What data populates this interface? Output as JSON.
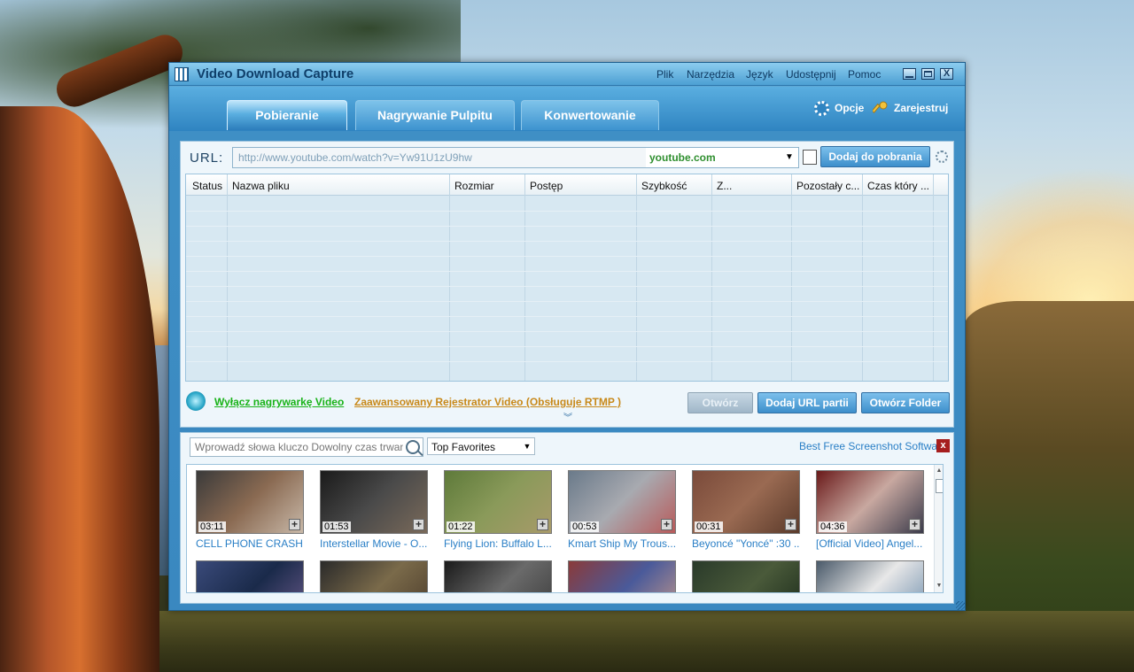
{
  "app": {
    "title": "Video Download Capture"
  },
  "menu": [
    {
      "label": "Plik"
    },
    {
      "label": "Narzędzia"
    },
    {
      "label": "Język"
    },
    {
      "label": "Udostępnij"
    },
    {
      "label": "Pomoc"
    }
  ],
  "window_controls": {
    "close_glyph": "X"
  },
  "tabs": [
    {
      "label": "Pobieranie",
      "active": true
    },
    {
      "label": "Nagrywanie Pulpitu",
      "active": false
    },
    {
      "label": "Konwertowanie",
      "active": false
    }
  ],
  "toolbar": {
    "options_label": "Opcje",
    "register_label": "Zarejestruj"
  },
  "url_bar": {
    "label": "URL:",
    "value": "http://www.youtube.com/watch?v=Yw91U1zU9hw",
    "site": "youtube.com",
    "add_button": "Dodaj do pobrania"
  },
  "table": {
    "columns": [
      "Status",
      "Nazwa pliku",
      "Rozmiar",
      "Postęp",
      "Szybkość",
      "Z...",
      "Pozostały c...",
      "Czas który ..."
    ],
    "rows": []
  },
  "actions": {
    "toggle_recorder": "Wyłącz nagrywarkę Video",
    "advanced_recorder": "Zaawansowany Rejestrator Video  (Obsługuje RTMP )",
    "open_button": "Otwórz",
    "add_batch_button": "Dodaj URL partii",
    "open_folder_button": "Otwórz Folder"
  },
  "gallery": {
    "search_placeholder": "Wprowadź słowa kluczo Dowolny czas trwania",
    "category": "Top Favorites",
    "promo_link": "Best Free Screenshot Software",
    "close_glyph": "x",
    "add_glyph": "+",
    "videos": [
      {
        "duration": "03:11",
        "title": "CELL PHONE CRASHI...",
        "colors": [
          "#3a3a3a",
          "#8a6a52",
          "#c8b8a8"
        ]
      },
      {
        "duration": "01:53",
        "title": "Interstellar Movie - O...",
        "colors": [
          "#1a1a1a",
          "#4a4a4a",
          "#7a6a5a"
        ]
      },
      {
        "duration": "01:22",
        "title": "Flying Lion: Buffalo L...",
        "colors": [
          "#5e7a3a",
          "#8a9a5a",
          "#a89a6a"
        ]
      },
      {
        "duration": "00:53",
        "title": "Kmart Ship My Trous...",
        "colors": [
          "#6a7a8a",
          "#a8aab0",
          "#b85a5a"
        ]
      },
      {
        "duration": "00:31",
        "title": "Beyoncé \"Yoncé\" :30 ...",
        "colors": [
          "#7a4a3a",
          "#9a6a52",
          "#5a3a2a"
        ]
      },
      {
        "duration": "04:36",
        "title": "[Official Video] Angel...",
        "colors": [
          "#6a1a1a",
          "#c8a8a0",
          "#3a3a4a"
        ]
      }
    ],
    "videos_row2": [
      {
        "colors": [
          "#3a4a7a",
          "#1a2a4a",
          "#6a5a8a"
        ]
      },
      {
        "colors": [
          "#2a2a2a",
          "#7a6a4a",
          "#4a3a2a"
        ]
      },
      {
        "colors": [
          "#1a1a1a",
          "#6a6a6a",
          "#3a3a3a"
        ]
      },
      {
        "colors": [
          "#8a3a3a",
          "#4a5a9a",
          "#c89a8a"
        ]
      },
      {
        "colors": [
          "#2a3a2a",
          "#4a5a3a",
          "#1a2a1a"
        ]
      },
      {
        "colors": [
          "#4a5a6a",
          "#e8e8e8",
          "#6a8aaa"
        ]
      }
    ]
  }
}
